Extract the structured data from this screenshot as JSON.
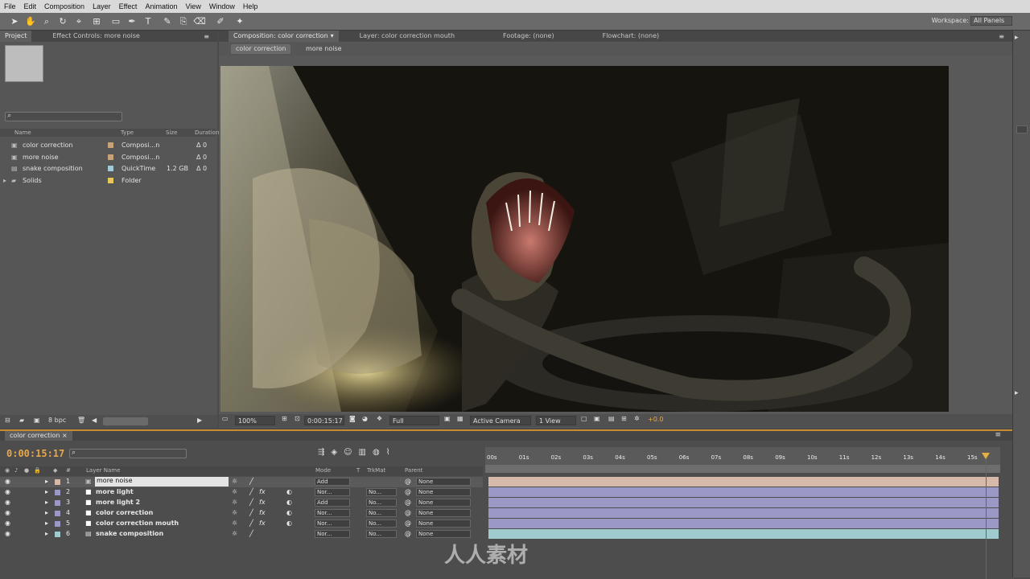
{
  "menu": [
    "File",
    "Edit",
    "Composition",
    "Layer",
    "Effect",
    "Animation",
    "View",
    "Window",
    "Help"
  ],
  "workspace": {
    "label": "Workspace:",
    "value": "All Panels"
  },
  "project_panel": {
    "tabs": [
      "Project",
      "Effect Controls: more noise"
    ],
    "columns": [
      "Name",
      "Type",
      "Size",
      "Duration"
    ],
    "items": [
      {
        "name": "color correction",
        "type": "Composi...n",
        "size": "",
        "duration": "Δ 0",
        "color": "#c9a27a"
      },
      {
        "name": "more noise",
        "type": "Composi...n",
        "size": "",
        "duration": "Δ 0",
        "color": "#c9a27a"
      },
      {
        "name": "snake composition",
        "type": "QuickTime",
        "size": "1.2 GB",
        "duration": "Δ 0",
        "color": "#9ecbd6"
      },
      {
        "name": "Solids",
        "type": "Folder",
        "size": "",
        "duration": "",
        "color": "#e6c85a"
      }
    ],
    "bpc": "8 bpc"
  },
  "viewer": {
    "tabs": [
      "Composition: color correction",
      "Layer: color correction mouth",
      "Footage: (none)",
      "Flowchart: (none)"
    ],
    "crumbs": [
      "color correction",
      "more noise"
    ],
    "zoom": "100%",
    "time": "0:00:15:17",
    "resolution": "Full",
    "camera": "Active Camera",
    "views": "1 View",
    "exposure": "+0.0"
  },
  "timeline": {
    "tab": "color correction",
    "timecode": "0:00:15:17",
    "columns": {
      "layer_name": "Layer Name",
      "mode": "Mode",
      "t": "T",
      "trkmat": "TrkMat",
      "parent": "Parent"
    },
    "ruler": [
      "00s",
      "01s",
      "02s",
      "03s",
      "04s",
      "05s",
      "06s",
      "07s",
      "08s",
      "09s",
      "10s",
      "11s",
      "12s",
      "13s",
      "14s",
      "15s"
    ],
    "layers": [
      {
        "num": "1",
        "name": "more noise",
        "mode": "Add",
        "trkmat": "",
        "parent": "None",
        "bar": "#d6b9a8"
      },
      {
        "num": "2",
        "name": "more light",
        "mode": "Nor...",
        "trkmat": "No...",
        "parent": "None",
        "bar": "#9c98c6"
      },
      {
        "num": "3",
        "name": "more light 2",
        "mode": "Add",
        "trkmat": "No...",
        "parent": "None",
        "bar": "#9c98c6"
      },
      {
        "num": "4",
        "name": "color correction",
        "mode": "Nor...",
        "trkmat": "No...",
        "parent": "None",
        "bar": "#9c98c6"
      },
      {
        "num": "5",
        "name": "color correction mouth",
        "mode": "Nor...",
        "trkmat": "No...",
        "parent": "None",
        "bar": "#9c98c6"
      },
      {
        "num": "6",
        "name": "snake composition",
        "mode": "Nor...",
        "trkmat": "No...",
        "parent": "None",
        "bar": "#9fcbcf"
      }
    ]
  },
  "watermark_text": "人人素材",
  "icons": [
    "search-icon",
    "folder-icon",
    "composition-icon",
    "trash-icon",
    "eye-icon",
    "camera-icon"
  ]
}
